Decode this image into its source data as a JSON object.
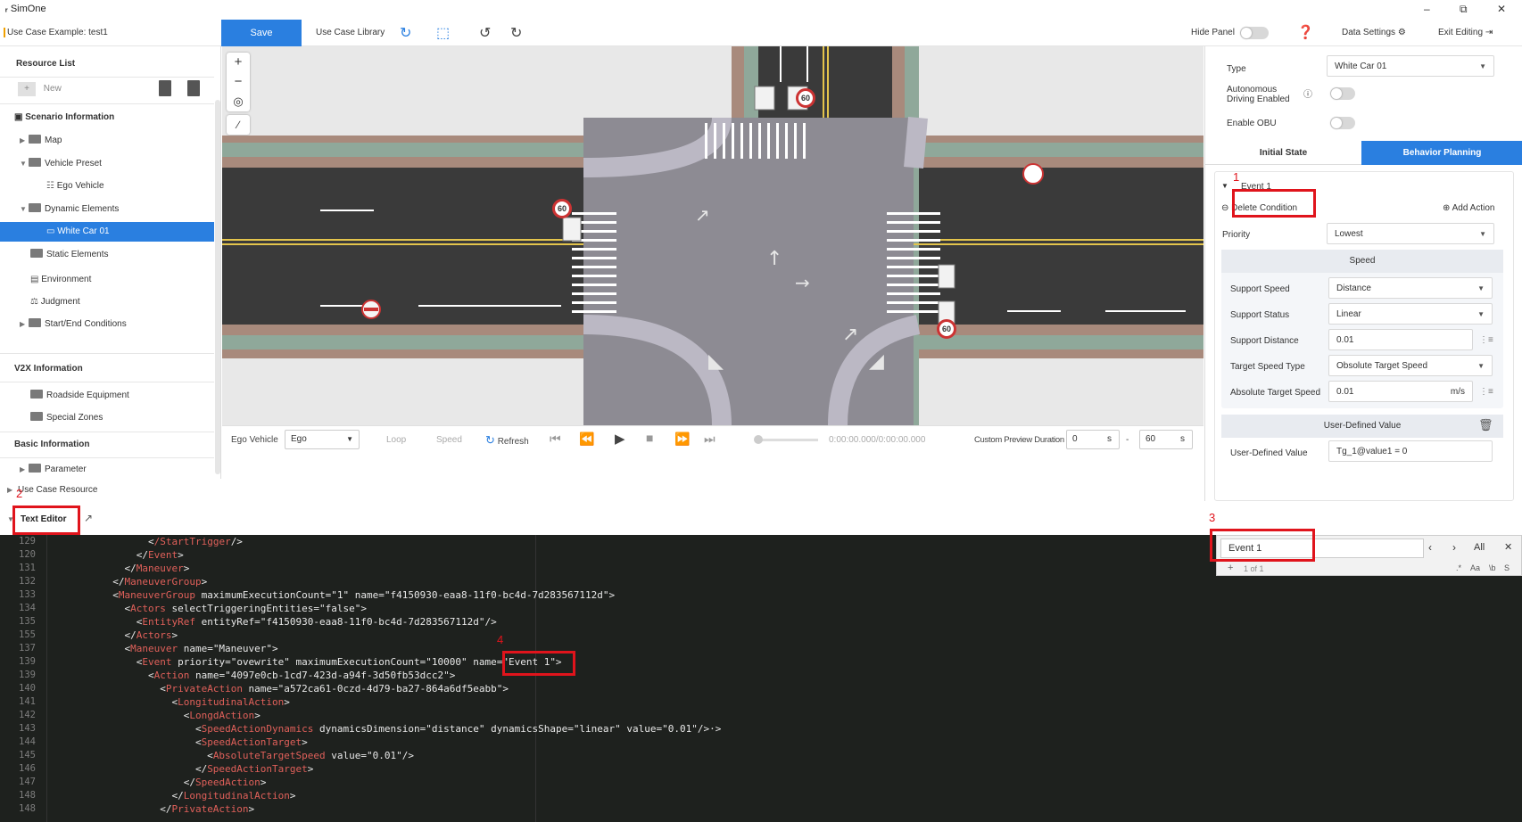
{
  "titlebar": {
    "app_name": "SimOne"
  },
  "toolbar": {
    "use_case": "Use Case Example: test1",
    "save": "Save",
    "library": "Use Case Library",
    "hide_panel": "Hide Panel",
    "data_settings": "Data Settings",
    "exit_editing": "Exit Editing"
  },
  "left_panel": {
    "resource_list": "Resource List",
    "new": "New",
    "scenario_info": "Scenario Information",
    "items": [
      {
        "label": "Map"
      },
      {
        "label": "Vehicle Preset"
      },
      {
        "label": "Ego Vehicle"
      },
      {
        "label": "Dynamic Elements"
      },
      {
        "label": "White Car 01"
      },
      {
        "label": "Static Elements"
      },
      {
        "label": "Environment"
      },
      {
        "label": "Judgment"
      },
      {
        "label": "Start/End Conditions"
      }
    ],
    "v2x": "V2X Information",
    "v2x_items": [
      {
        "label": "Roadside Equipment"
      },
      {
        "label": "Special Zones"
      }
    ],
    "basic": "Basic Information",
    "parameter": "Parameter",
    "use_case_resource": "Use Case Resource"
  },
  "map": {
    "signs": [
      "60",
      "60",
      "60"
    ]
  },
  "playback": {
    "ego_label": "Ego Vehicle",
    "ego_value": "Ego",
    "loop": "Loop",
    "speed": "Speed",
    "refresh": "Refresh",
    "time": "0:00:00.000/0:00:00.000",
    "preview_label": "Custom Preview Duration",
    "from": "0",
    "unit1": "s",
    "dash": "-",
    "to": "60",
    "unit2": "s"
  },
  "right_panel": {
    "type_label": "Type",
    "type_value": "White Car 01",
    "autonomous_label": "Autonomous Driving Enabled",
    "obu_label": "Enable OBU",
    "tab_initial": "Initial State",
    "tab_behavior": "Behavior Planning",
    "event_name": "Event 1",
    "delete_condition": "Delete Condition",
    "add_action": "Add Action",
    "priority_label": "Priority",
    "priority_value": "Lowest",
    "speed_header": "Speed",
    "support_speed_label": "Support Speed",
    "support_speed_value": "Distance",
    "support_status_label": "Support Status",
    "support_status_value": "Linear",
    "support_distance_label": "Support Distance",
    "support_distance_value": "0.01",
    "target_type_label": "Target Speed Type",
    "target_type_value": "Obsolute Target Speed",
    "abs_speed_label": "Absolute Target Speed",
    "abs_speed_value": "0.01",
    "abs_speed_unit": "m/s",
    "udv_header": "User-Defined Value",
    "udv_label": "User-Defined Value",
    "udv_value": "Tg_1@value1 = 0"
  },
  "editor": {
    "tab": "Text Editor",
    "find_value": "Event 1",
    "find_count": "1 of 1",
    "find_all": "All",
    "opt_regex": ".*",
    "opt_case": "Aa",
    "opt_word": "\\b",
    "opt_sel": "S",
    "lines": [
      {
        "n": "129",
        "pre": "                <",
        "tag": "/StartTrigger",
        "rest": "/>"
      },
      {
        "n": "120",
        "pre": "              </",
        "tag": "Event",
        "rest": ">"
      },
      {
        "n": "131",
        "pre": "            </",
        "tag": "Maneuver",
        "rest": ">"
      },
      {
        "n": "132",
        "pre": "          </",
        "tag": "ManeuverGroup",
        "rest": ">"
      },
      {
        "n": "133",
        "pre": "          <",
        "tag": "ManeuverGroup",
        "rest": " maximumExecutionCount=\"1\" name=\"f4150930-eaa8-11f0-bc4d-7d283567112d\">"
      },
      {
        "n": "134",
        "pre": "            <",
        "tag": "Actors",
        "rest": " selectTriggeringEntities=\"false\">"
      },
      {
        "n": "135",
        "pre": "              <",
        "tag": "EntityRef",
        "rest": " entityRef=\"f4150930-eaa8-11f0-bc4d-7d283567112d\"/>"
      },
      {
        "n": "155",
        "pre": "            </",
        "tag": "Actors",
        "rest": ">"
      },
      {
        "n": "137",
        "pre": "            <",
        "tag": "Maneuver",
        "rest": " name=\"Maneuver\">"
      },
      {
        "n": "139",
        "pre": "              <",
        "tag": "Event",
        "rest": " priority=\"ovewrite\" maximumExecutionCount=\"10000\" name=\"Event 1\">"
      },
      {
        "n": "139",
        "pre": "                <",
        "tag": "Action",
        "rest": " name=\"4097e0cb-1cd7-423d-a94f-3d50fb53dcc2\">"
      },
      {
        "n": "140",
        "pre": "                  <",
        "tag": "PrivateAction",
        "rest": " name=\"a572ca61-0czd-4d79-ba27-864a6df5eabb\">"
      },
      {
        "n": "141",
        "pre": "                    <",
        "tag": "LongitudinalAction",
        "rest": ">"
      },
      {
        "n": "142",
        "pre": "                      <",
        "tag": "LongdAction",
        "rest": ">"
      },
      {
        "n": "143",
        "pre": "                        <",
        "tag": "SpeedActionDynamics",
        "rest": " dynamicsDimension=\"distance\" dynamicsShape=\"linear\" value=\"0.01\"/>·>"
      },
      {
        "n": "144",
        "pre": "                        <",
        "tag": "SpeedActionTarget",
        "rest": ">"
      },
      {
        "n": "145",
        "pre": "                          <",
        "tag": "AbsoluteTargetSpeed",
        "rest": " value=\"0.01\"/>"
      },
      {
        "n": "146",
        "pre": "                        </",
        "tag": "SpeedActionTarget",
        "rest": ">"
      },
      {
        "n": "147",
        "pre": "                      </",
        "tag": "SpeedAction",
        "rest": ">"
      },
      {
        "n": "148",
        "pre": "                    </",
        "tag": "LongitudinalAction",
        "rest": ">"
      },
      {
        "n": "148",
        "pre": "                  </",
        "tag": "PrivateAction",
        "rest": ">"
      }
    ]
  },
  "annotations": [
    "1",
    "2",
    "3",
    "4"
  ]
}
